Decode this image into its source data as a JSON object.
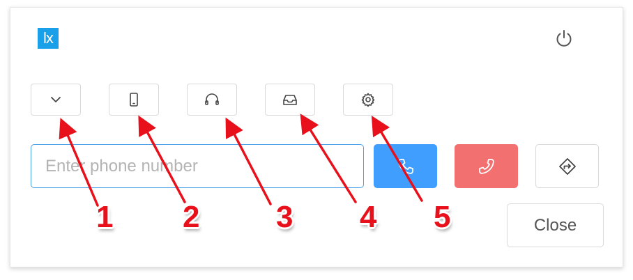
{
  "app": {
    "logo_text": "lx",
    "brand_color": "#1aa0e8"
  },
  "header": {
    "power_icon": "power-icon"
  },
  "toolbar": {
    "buttons": [
      {
        "icon": "chevron-down-icon"
      },
      {
        "icon": "mobile-phone-icon"
      },
      {
        "icon": "headset-icon"
      },
      {
        "icon": "inbox-icon"
      },
      {
        "icon": "gear-icon"
      }
    ]
  },
  "dialer": {
    "phone_value": "",
    "phone_placeholder": "Enter phone number",
    "call_icon": "phone-call-icon",
    "call_color": "#409eff",
    "hangup_icon": "phone-hangup-icon",
    "hangup_color": "#f27070",
    "transfer_icon": "transfer-direction-icon",
    "close_label": "Close"
  },
  "annotations": {
    "color": "#e8101a",
    "labels": [
      "1",
      "2",
      "3",
      "4",
      "5"
    ]
  }
}
